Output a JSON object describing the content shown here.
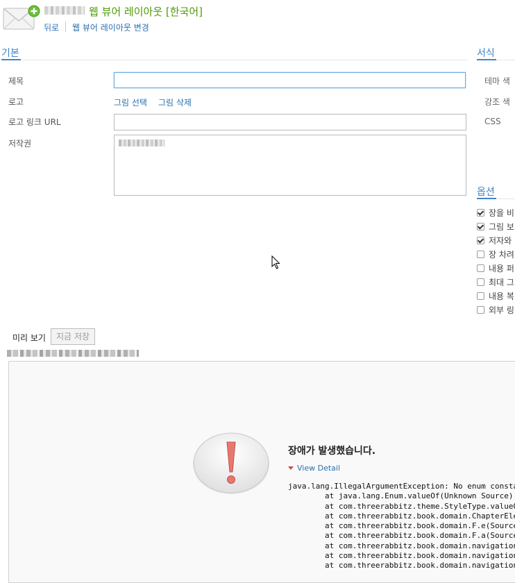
{
  "header": {
    "title": "웹 뷰어 레이아웃 [한국어]",
    "back_label": "뒤로",
    "change_layout_label": "웹 뷰어 레이아웃 변경"
  },
  "basic": {
    "section_title": "기본",
    "fields": {
      "title_label": "제목",
      "title_value": "",
      "logo_label": "로고",
      "logo_select": "그림 선택",
      "logo_delete": "그림 삭제",
      "logo_link_label": "로고 링크 URL",
      "logo_link_value": "",
      "copyright_label": "저작권"
    }
  },
  "format": {
    "section_title": "서식",
    "theme_color": "테마 색",
    "accent_color": "강조 색",
    "css": "CSS"
  },
  "options": {
    "section_title": "옵션",
    "items": [
      {
        "label": "장을 비",
        "checked": true
      },
      {
        "label": "그림 보",
        "checked": true
      },
      {
        "label": "저자와",
        "checked": true
      },
      {
        "label": "장 차려",
        "checked": false
      },
      {
        "label": "내용 퍼",
        "checked": false
      },
      {
        "label": "최대 그",
        "checked": false
      },
      {
        "label": "내용 복",
        "checked": false
      },
      {
        "label": "외부 링",
        "checked": false
      }
    ]
  },
  "preview": {
    "label": "미리 보기",
    "save_now": "지금 저장"
  },
  "error": {
    "title": "장애가 발생했습니다.",
    "view_detail": "View Detail",
    "stack_lines": [
      "java.lang.IllegalArgumentException: No enum consta",
      "        at java.lang.Enum.valueOf(Unknown Source)",
      "        at com.threerabbitz.theme.StyleType.valueO",
      "        at com.threerabbitz.book.domain.ChapterEle",
      "        at com.threerabbitz.book.domain.F.e(Source",
      "        at com.threerabbitz.book.domain.F.a(Source",
      "        at com.threerabbitz.book.domain.navigation",
      "        at com.threerabbitz.book.domain.navigation",
      "        at com.threerabbitz.book.domain.navigation"
    ]
  },
  "colors": {
    "title_green": "#4e9a06",
    "link_blue": "#2a6fb0",
    "section_blue": "#3f86c6",
    "error_red": "#c0504d"
  }
}
